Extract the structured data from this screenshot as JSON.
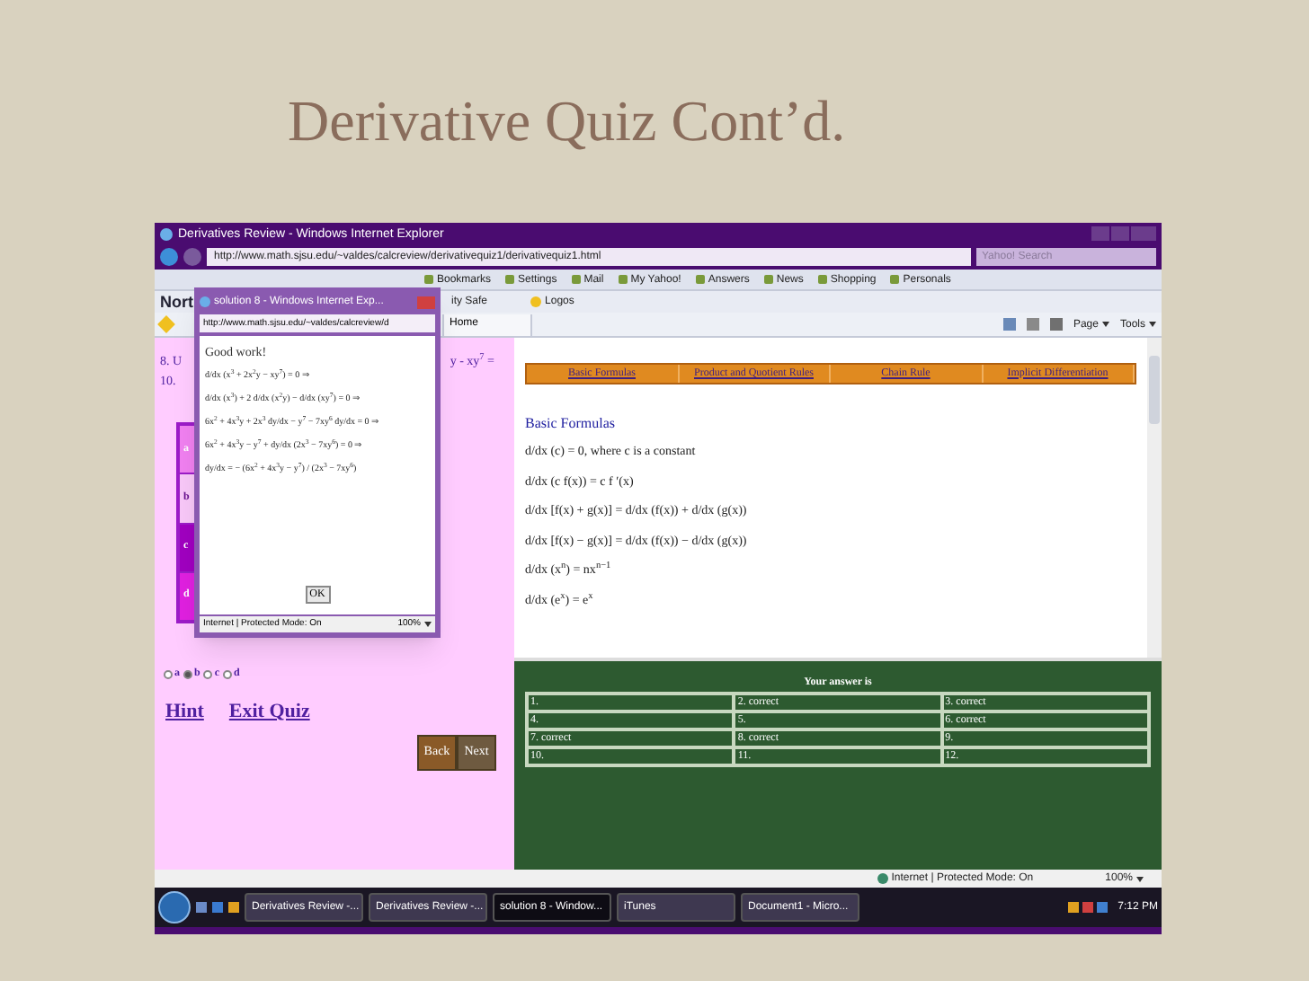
{
  "slide": {
    "title": "Derivative Quiz Cont’d."
  },
  "browser": {
    "title": "Derivatives Review - Windows Internet Explorer",
    "url": "http://www.math.sjsu.edu/~valdes/calcreview/derivativequiz1/derivativequiz1.html",
    "search_placeholder": "Yahoo! Search",
    "toolbar": [
      "Bookmarks",
      "Settings",
      "Mail",
      "My Yahoo!",
      "Answers",
      "News",
      "Shopping",
      "Personals"
    ],
    "toolbar2": [
      "Nort",
      "ity Safe",
      "Logos"
    ],
    "tab": "Home",
    "command_bar": [
      "Page",
      "Tools"
    ],
    "status": "Internet | Protected Mode: On",
    "zoom": "100%"
  },
  "quiz": {
    "question_start": "8. U",
    "question_end": "y - xy$^{7}$ =",
    "question_line2": "10.",
    "options": [
      {
        "label": "a",
        "color": "#f080f0"
      },
      {
        "label": "b",
        "color": "#f8c8f8"
      },
      {
        "label": "c",
        "color": "#a000c0"
      },
      {
        "label": "d",
        "color": "#e020e0"
      }
    ],
    "radios": [
      {
        "label": "a",
        "selected": false
      },
      {
        "label": "b",
        "selected": true
      },
      {
        "label": "c",
        "selected": false
      },
      {
        "label": "d",
        "selected": false
      }
    ],
    "links": [
      "Hint",
      "Exit Quiz"
    ],
    "buttons": [
      "Back",
      "Next"
    ]
  },
  "nav": [
    "Basic Formulas",
    "Product and Quotient Rules",
    "Chain Rule",
    "Implicit Differentiation"
  ],
  "formulas": {
    "heading": "Basic Formulas",
    "items": [
      "d/dx (c) = 0, where c is a constant",
      "d/dx (c f(x)) = c f ′(x)",
      "d/dx [f(x) + g(x)] = d/dx (f(x)) + d/dx (g(x))",
      "d/dx [f(x) − g(x)] = d/dx (f(x)) − d/dx (g(x))",
      "d/dx (x$^{n}$) = nx$^{n−1}$",
      "d/dx (e$^{x}$) = e$^{x}$"
    ]
  },
  "results": {
    "heading": "Your answer is",
    "cells": [
      "1.",
      "2. correct",
      "3. correct",
      "4.",
      "5.",
      "6. correct",
      "7. correct",
      "8. correct",
      "9.",
      "10.",
      "11.",
      "12."
    ]
  },
  "popup": {
    "title": "solution 8 - Windows Internet Exp...",
    "url": "http://www.math.sjsu.edu/~valdes/calcreview/d",
    "message": "Good work!",
    "steps": [
      "d/dx (x$^{3}$ + 2x$^{2}$y − xy$^{7}$) = 0 ⇒",
      "d/dx (x$^{3}$) + 2 d/dx (x$^{2}$y) − d/dx (xy$^{7}$) = 0 ⇒",
      "6x$^{2}$ + 4x$^{3}$y + 2x$^{3}$ dy/dx − y$^{7}$ − 7xy$^{6}$ dy/dx = 0 ⇒",
      "6x$^{2}$ + 4x$^{3}$y − y$^{7}$ + dy/dx (2x$^{3}$ − 7xy$^{6}$) = 0 ⇒",
      "dy/dx = − (6x$^{2}$ + 4x$^{3}$y − y$^{7}$) / (2x$^{3}$ − 7xy$^{6}$)"
    ],
    "ok": "OK",
    "status": "Internet | Protected Mode: On",
    "zoom": "100%"
  },
  "taskbar": {
    "tasks": [
      {
        "label": "Derivatives Review -...",
        "selected": false
      },
      {
        "label": "Derivatives Review -...",
        "selected": false
      },
      {
        "label": "solution 8 - Window...",
        "selected": true
      },
      {
        "label": "iTunes",
        "selected": false
      },
      {
        "label": "Document1 - Micro...",
        "selected": false
      }
    ],
    "clock": "7:12 PM"
  }
}
